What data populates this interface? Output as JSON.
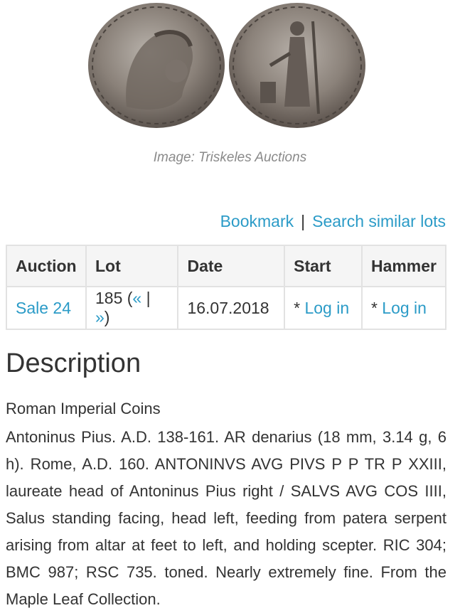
{
  "image_caption": "Image: Triskeles Auctions",
  "coin": {
    "obverse_legend": "ANTONINVS AVG PIVS P P TR P XXIII",
    "reverse_legend": "SALVS AVG COS IIII"
  },
  "links": {
    "bookmark": "Bookmark",
    "separator": "|",
    "search_similar": "Search similar lots"
  },
  "table": {
    "headers": [
      "Auction",
      "Lot",
      "Date",
      "Start",
      "Hammer"
    ],
    "row": {
      "auction": "Sale 24",
      "lot_number": "185 (",
      "lot_prev": "«",
      "lot_sep": " | ",
      "lot_next": "»",
      "lot_close": ")",
      "date": "16.07.2018",
      "start_prefix": "* ",
      "start_link": "Log in",
      "hammer_prefix": "* ",
      "hammer_link": "Log in"
    }
  },
  "description": {
    "title": "Description",
    "category": "Roman Imperial Coins",
    "text": "Antoninus Pius. A.D. 138-161. AR denarius (18 mm, 3.14 g, 6 h). Rome, A.D. 160. ANTONINVS AVG PIVS P P TR P XXIII, laureate head of Antoninus Pius right / SALVS AVG COS IIII, Salus standing facing, head left, feeding from patera serpent arising from altar at feet to left, and holding scepter. RIC 304; BMC 987; RSC 735. toned. Nearly extremely fine. From the Maple Leaf Collection."
  },
  "colors": {
    "link": "#2b9bc7",
    "text": "#333333",
    "caption": "#8a8a8a",
    "table_border": "#e2e2e2",
    "table_header_bg": "#f5f5f5"
  }
}
